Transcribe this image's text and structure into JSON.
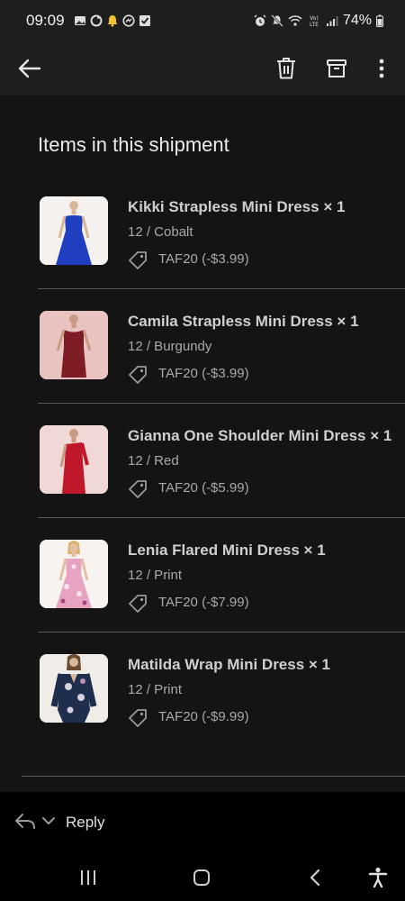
{
  "status_bar": {
    "time": "09:09",
    "battery": "74%",
    "left_icons": [
      "gallery-icon",
      "sync-icon",
      "bell-icon",
      "messenger-icon",
      "check-box-icon"
    ],
    "right_icons": [
      "alarm-icon",
      "mute-icon",
      "wifi-icon",
      "volte-icon",
      "signal-icon",
      "battery-icon"
    ]
  },
  "app_bar": {
    "icons": [
      "back-arrow-icon",
      "trash-icon",
      "archive-icon",
      "more-vert-icon"
    ]
  },
  "shipment": {
    "title": "Items in this shipment",
    "items": [
      {
        "name": "Kikki Strapless Mini Dress × 1",
        "variant": "12 / Cobalt",
        "promo": "TAF20 (-$3.99)",
        "dress_color": "#1f3fc0",
        "bg_color": "#f4f1ee"
      },
      {
        "name": "Camila Strapless Mini Dress × 1",
        "variant": "12 / Burgundy",
        "promo": "TAF20 (-$3.99)",
        "dress_color": "#7e1c26",
        "bg_color": "#e9c3c0"
      },
      {
        "name": "Gianna One Shoulder Mini Dress × 1",
        "variant": "12 / Red",
        "promo": "TAF20 (-$5.99)",
        "dress_color": "#c0182a",
        "bg_color": "#efd8d5"
      },
      {
        "name": "Lenia Flared Mini Dress × 1",
        "variant": "12 / Print",
        "promo": "TAF20 (-$7.99)",
        "dress_color": "#e8a3c3",
        "bg_color": "#f7f3f0"
      },
      {
        "name": "Matilda Wrap Mini Dress × 1",
        "variant": "12 / Print",
        "promo": "TAF20 (-$9.99)",
        "dress_color": "#1e2e4c",
        "bg_color": "#f0ece7"
      }
    ]
  },
  "reply_bar": {
    "label": "Reply"
  },
  "nav_bar": {
    "icons": [
      "recent-apps-icon",
      "home-icon",
      "back-icon",
      "accessibility-icon"
    ]
  }
}
